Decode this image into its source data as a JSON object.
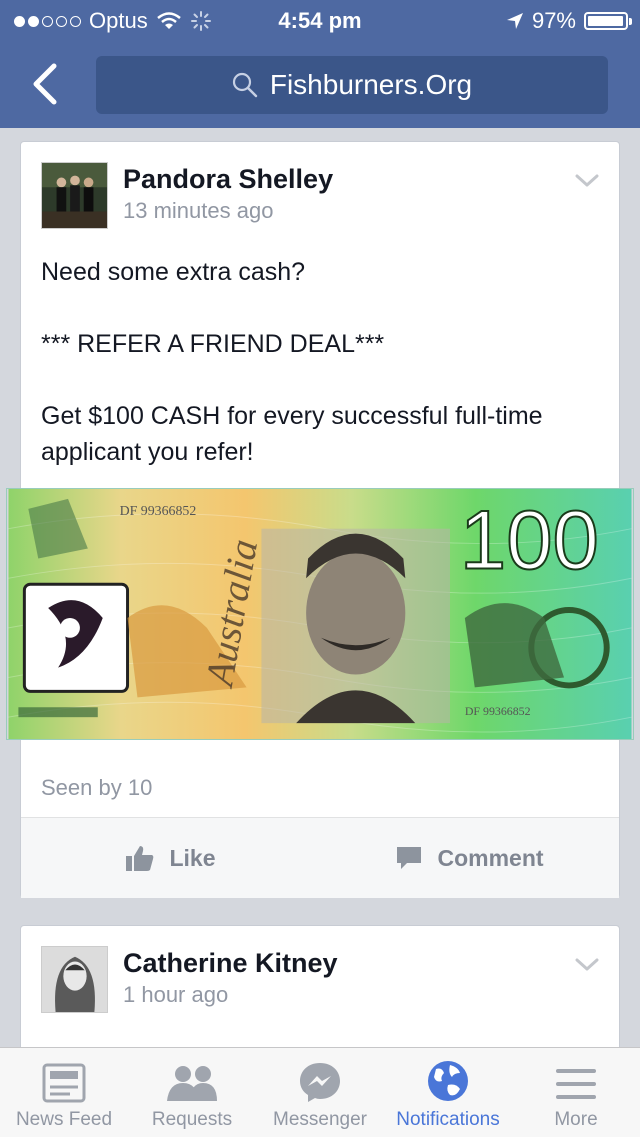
{
  "status": {
    "carrier": "Optus",
    "time": "4:54 pm",
    "battery": "97%",
    "battery_level": 0.97
  },
  "nav": {
    "search_text": "Fishburners.Org",
    "icons": [
      "back-chevron-icon",
      "search-icon"
    ]
  },
  "posts": [
    {
      "author": "Pandora Shelley",
      "timestamp": "13 minutes ago",
      "text_lines": [
        "Need some extra cash?",
        "*** REFER A FRIEND DEAL***",
        "Get $100 CASH for every successful full-time applicant you refer!"
      ],
      "image": {
        "serial": "DF 99366852",
        "denomination": "100",
        "country": "Australia"
      },
      "seen": "Seen by 10",
      "actions": {
        "like": "Like",
        "comment": "Comment"
      }
    },
    {
      "author": "Catherine Kitney",
      "timestamp": "1 hour ago"
    }
  ],
  "tabs": [
    {
      "label": "News Feed",
      "icon": "news-feed-icon"
    },
    {
      "label": "Requests",
      "icon": "requests-icon"
    },
    {
      "label": "Messenger",
      "icon": "messenger-icon"
    },
    {
      "label": "Notifications",
      "icon": "globe-icon",
      "active": true
    },
    {
      "label": "More",
      "icon": "menu-icon"
    }
  ],
  "colors": {
    "header": "#4e69a2",
    "search_bg": "#3b5689",
    "active_tab": "#4a76d8"
  }
}
